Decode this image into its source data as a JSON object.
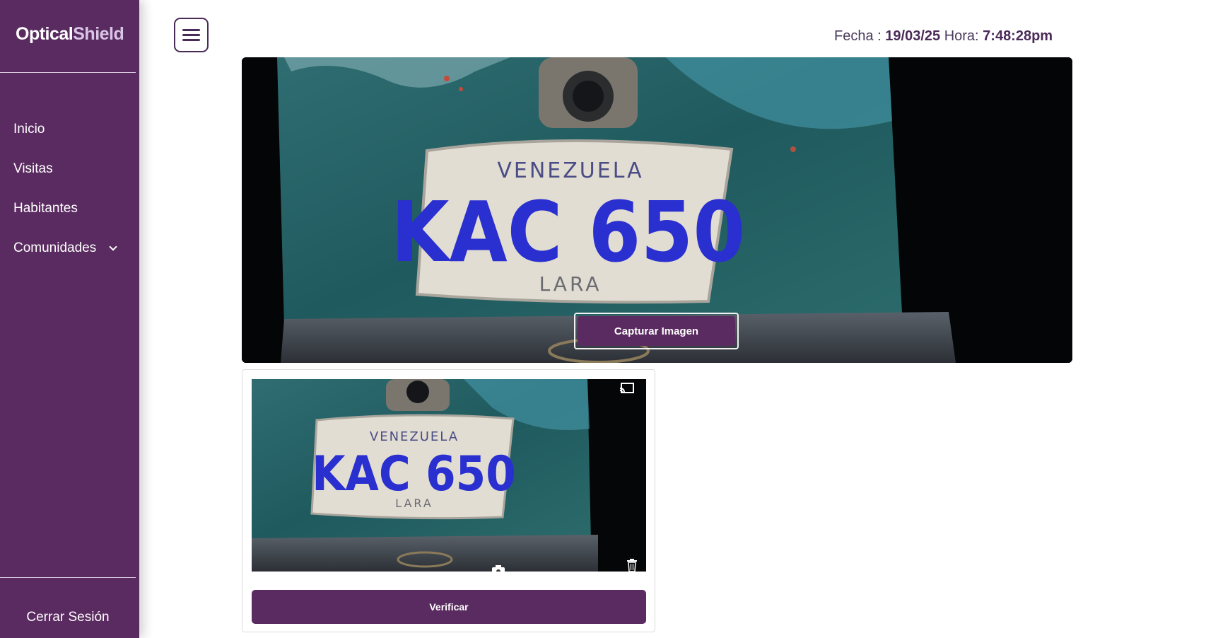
{
  "brand": {
    "part1": "Optical",
    "part2": "Shield"
  },
  "sidebar": {
    "items": [
      {
        "label": "Inicio"
      },
      {
        "label": "Visitas"
      },
      {
        "label": "Habitantes"
      },
      {
        "label": "Comunidades",
        "has_submenu": true
      }
    ],
    "logout_label": "Cerrar Sesión"
  },
  "header": {
    "date_label": "Fecha :",
    "date_value": "19/03/25",
    "time_label": "Hora:",
    "time_value": "7:48:28pm"
  },
  "camera": {
    "capture_label": "Capturar Imagen",
    "plate": {
      "country": "VENEZUELA",
      "number": "KAC 650",
      "state": "LARA"
    }
  },
  "snapshot": {
    "verify_label": "Verificar",
    "icons": [
      "cast-icon",
      "camera-icon",
      "trash-icon"
    ]
  },
  "colors": {
    "primary": "#5a2b60",
    "sidebar_text": "#ffffff",
    "plate_text": "#2a2fd0"
  }
}
